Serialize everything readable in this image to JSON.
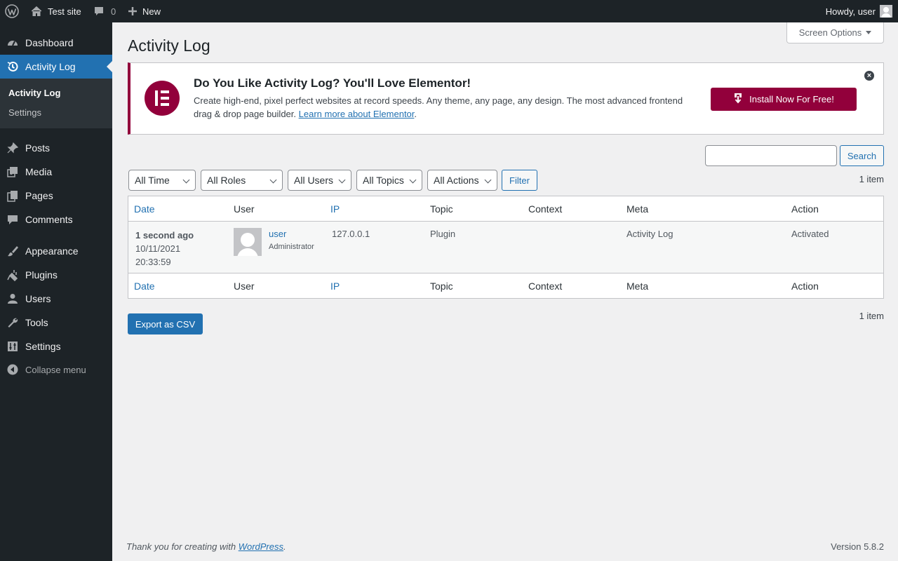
{
  "admin_bar": {
    "site_name": "Test site",
    "comments_count": "0",
    "new_label": "New",
    "howdy": "Howdy, user"
  },
  "sidebar": {
    "items": [
      {
        "label": "Dashboard",
        "icon": "dashboard-icon"
      },
      {
        "label": "Activity Log",
        "icon": "history-icon"
      },
      {
        "label": "Posts",
        "icon": "pin-icon"
      },
      {
        "label": "Media",
        "icon": "media-icon"
      },
      {
        "label": "Pages",
        "icon": "pages-icon"
      },
      {
        "label": "Comments",
        "icon": "comment-icon"
      },
      {
        "label": "Appearance",
        "icon": "brush-icon"
      },
      {
        "label": "Plugins",
        "icon": "plugin-icon"
      },
      {
        "label": "Users",
        "icon": "user-icon"
      },
      {
        "label": "Tools",
        "icon": "wrench-icon"
      },
      {
        "label": "Settings",
        "icon": "settings-icon"
      }
    ],
    "submenu": [
      "Activity Log",
      "Settings"
    ],
    "collapse_label": "Collapse menu"
  },
  "page": {
    "title": "Activity Log",
    "screen_options": "Screen Options"
  },
  "promo": {
    "heading": "Do You Like Activity Log? You'll Love Elementor!",
    "description": "Create high-end, pixel perfect websites at record speeds. Any theme, any page, any design. The most advanced frontend drag & drop page builder.",
    "link_text": "Learn more about Elementor",
    "link_suffix": ".",
    "button_label": "Install Now For Free!",
    "accent": "#92003b"
  },
  "search": {
    "value": "",
    "button_label": "Search"
  },
  "filters": {
    "time": "All Time",
    "roles": "All Roles",
    "users": "All Users",
    "topics": "All Topics",
    "actions": "All Actions",
    "button_label": "Filter"
  },
  "items_count": "1 item",
  "table": {
    "columns": [
      "Date",
      "User",
      "IP",
      "Topic",
      "Context",
      "Meta",
      "Action"
    ],
    "rows": [
      {
        "time_ago": "1 second ago",
        "date": "10/11/2021",
        "time": "20:33:59",
        "user_name": "user",
        "user_role": "Administrator",
        "ip": "127.0.0.1",
        "topic": "Plugin",
        "context": "",
        "meta": "Activity Log",
        "action": "Activated"
      }
    ]
  },
  "export_label": "Export as CSV",
  "footer": {
    "thanks_prefix": "Thank you for creating with ",
    "thanks_link": "WordPress",
    "thanks_suffix": ".",
    "version": "Version 5.8.2"
  },
  "colors": {
    "admin_bar_bg": "#1d2327",
    "primary": "#2271b1",
    "elementor": "#92003b"
  }
}
